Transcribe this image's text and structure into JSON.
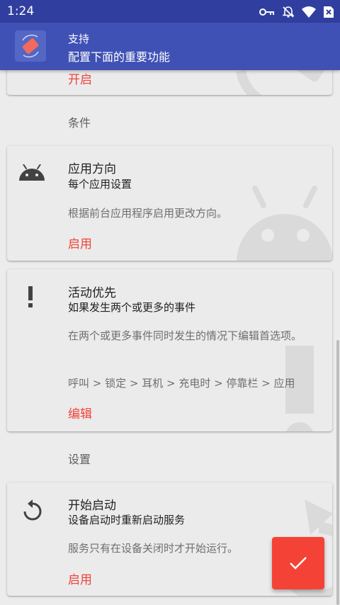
{
  "status_bar": {
    "time": "1:24",
    "icons": [
      "vpn-key-icon",
      "notifications-off-icon",
      "wifi-icon",
      "no-sim-icon"
    ]
  },
  "app_bar": {
    "title": "支持",
    "subtitle": "配置下面的重要功能",
    "logo_icon": "rotation-app-icon"
  },
  "top_card": {
    "action": "开启"
  },
  "sections": {
    "conditions": "条件",
    "settings": "设置"
  },
  "cards": {
    "app_orientation": {
      "icon": "android-icon",
      "title": "应用方向",
      "subtitle": "每个应用设置",
      "description": "根据前台应用程序启用更改方向。",
      "action": "启用"
    },
    "event_priority": {
      "icon": "exclamation-icon",
      "title": "活动优先",
      "subtitle": "如果发生两个或更多的事件",
      "description": "在两个或更多事件同时发生的情况下编辑首选项。",
      "order": "呼叫 > 锁定 > 耳机 > 充电时 > 停靠栏 > 应用",
      "action": "编辑"
    },
    "start_on_boot": {
      "icon": "restart-icon",
      "title": "开始启动",
      "subtitle": "设备启动时重新启动服务",
      "description": "服务只有在设备关闭时才开始运行。",
      "action": "启用"
    }
  },
  "fab": {
    "icon": "check-icon"
  },
  "colors": {
    "status_bar": "#303f9f",
    "app_bar": "#3f51b5",
    "accent": "#f44336",
    "action_text": "#f0443b",
    "background": "#ececec"
  }
}
